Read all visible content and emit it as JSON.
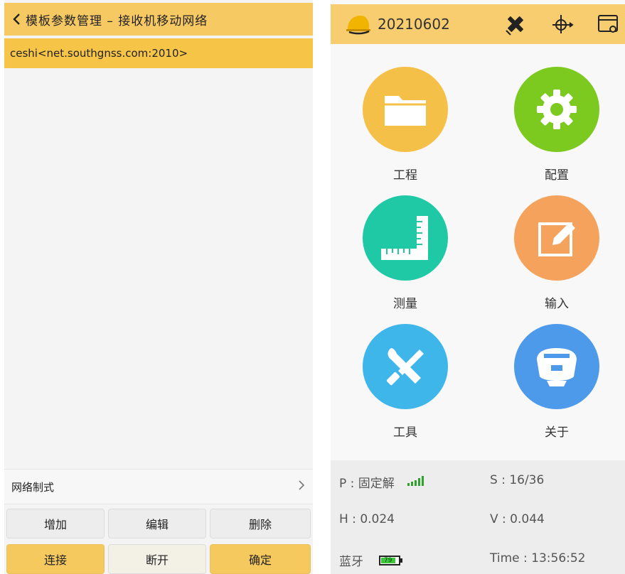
{
  "left_panel": {
    "header_title": "模板参数管理 – 接收机移动网络",
    "selected_item": "ceshi<net.southgnss.com:2010>",
    "network_mode_label": "网络制式",
    "buttons": {
      "add": "增加",
      "edit": "编辑",
      "delete": "删除",
      "connect": "连接",
      "disconnect": "断开",
      "confirm": "确定"
    }
  },
  "right_panel": {
    "device_id": "20210602",
    "top_icons": [
      "satellite-icon",
      "target-icon",
      "window-settings-icon"
    ],
    "tiles": [
      {
        "label": "工程",
        "icon": "folder-icon",
        "color": "#f5c048"
      },
      {
        "label": "配置",
        "icon": "gear-icon",
        "color": "#7cc91f"
      },
      {
        "label": "测量",
        "icon": "ruler-icon",
        "color": "#1fc9a6"
      },
      {
        "label": "输入",
        "icon": "edit-icon",
        "color": "#f5a25c"
      },
      {
        "label": "工具",
        "icon": "tools-icon",
        "color": "#3fb6ea"
      },
      {
        "label": "关于",
        "icon": "receiver-icon",
        "color": "#4e9aea"
      }
    ],
    "status": {
      "solution": "P : 固定解",
      "satellites": "S : 16/36",
      "h_precision": "H : 0.024",
      "v_precision": "V : 0.044",
      "bluetooth_label": "蓝牙",
      "battery_level": "79",
      "time": "Time :  13:56:52"
    }
  }
}
